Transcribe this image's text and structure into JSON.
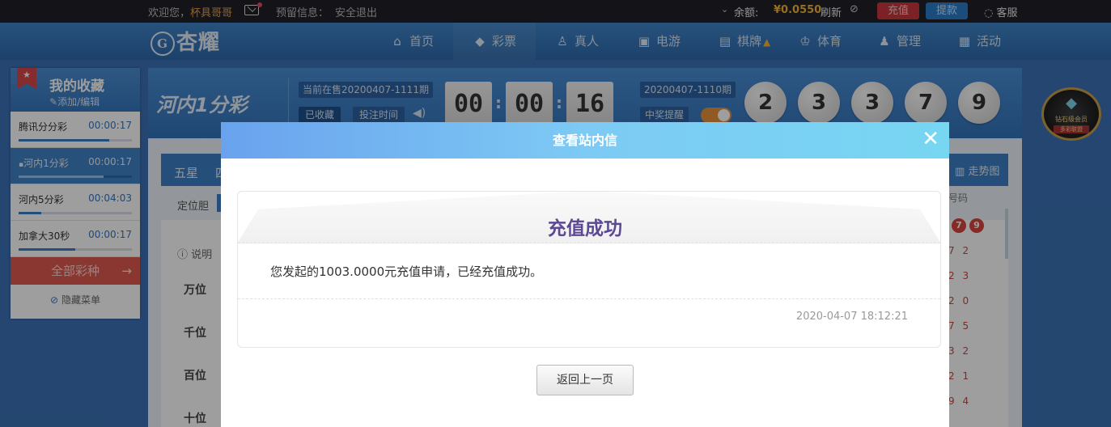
{
  "topbar": {
    "welcome": "欢迎您，",
    "username": "杯具哥哥",
    "reserved_label": "预留信息：",
    "logout": "安全退出",
    "balance_label": "余额:",
    "balance_value": "¥0.0550",
    "refresh": "刷新",
    "recharge": "充值",
    "withdraw": "提款",
    "service": "客服"
  },
  "nav": {
    "logo": "杏耀",
    "items": [
      {
        "label": "首页",
        "icon": "home-icon"
      },
      {
        "label": "彩票",
        "icon": "ticket-icon"
      },
      {
        "label": "真人",
        "icon": "person-icon"
      },
      {
        "label": "电游",
        "icon": "arcade-icon"
      },
      {
        "label": "棋牌",
        "icon": "cards-icon"
      },
      {
        "label": "体育",
        "icon": "trophy-icon"
      },
      {
        "label": "管理",
        "icon": "users-icon"
      },
      {
        "label": "活动",
        "icon": "gift-icon"
      }
    ]
  },
  "sidebar": {
    "title": "我的收藏",
    "edit": "添加/编辑",
    "items": [
      {
        "name": "腾讯分分彩",
        "time": "00:00:17",
        "progress": 0.8
      },
      {
        "name": "河内1分彩",
        "time": "00:00:17",
        "progress": 0.75
      },
      {
        "name": "河内5分彩",
        "time": "00:04:03",
        "progress": 0.2
      },
      {
        "name": "加拿大30秒",
        "time": "00:00:17",
        "progress": 0.5
      }
    ],
    "all_label": "全部彩种",
    "hide_label": "隐藏菜单"
  },
  "lottery": {
    "logo": "河内1分彩",
    "current_issue": "当前在售20200407-1111期",
    "fav_btn": "已收藏",
    "bet_time": "投注时间",
    "countdown": [
      "00",
      "00",
      "16"
    ],
    "last_issue": "20200407-1110期",
    "prize_remind": "中奖提醒",
    "balls": [
      "2",
      "3",
      "3",
      "7",
      "9"
    ]
  },
  "vip": {
    "title": "钻石级会员",
    "sub": "多彩联盟"
  },
  "bet": {
    "tab1": "五星",
    "tab2": "四",
    "trend": "走势图",
    "dingwei": "定位胆",
    "note": "说明",
    "positions": [
      "万位",
      "千位",
      "百位",
      "十位"
    ],
    "code_head": "号码",
    "top_balls": [
      "7",
      "9"
    ],
    "codes": [
      "7 2",
      "2 3",
      "2 0",
      "7 5",
      "3 2",
      "2 1",
      "9 4"
    ]
  },
  "modal": {
    "title": "查看站内信",
    "heading": "充值成功",
    "message": "您发起的1003.0000元充值申请，已经充值成功。",
    "date": "2020-04-07 18:12:21",
    "back": "返回上一页"
  }
}
